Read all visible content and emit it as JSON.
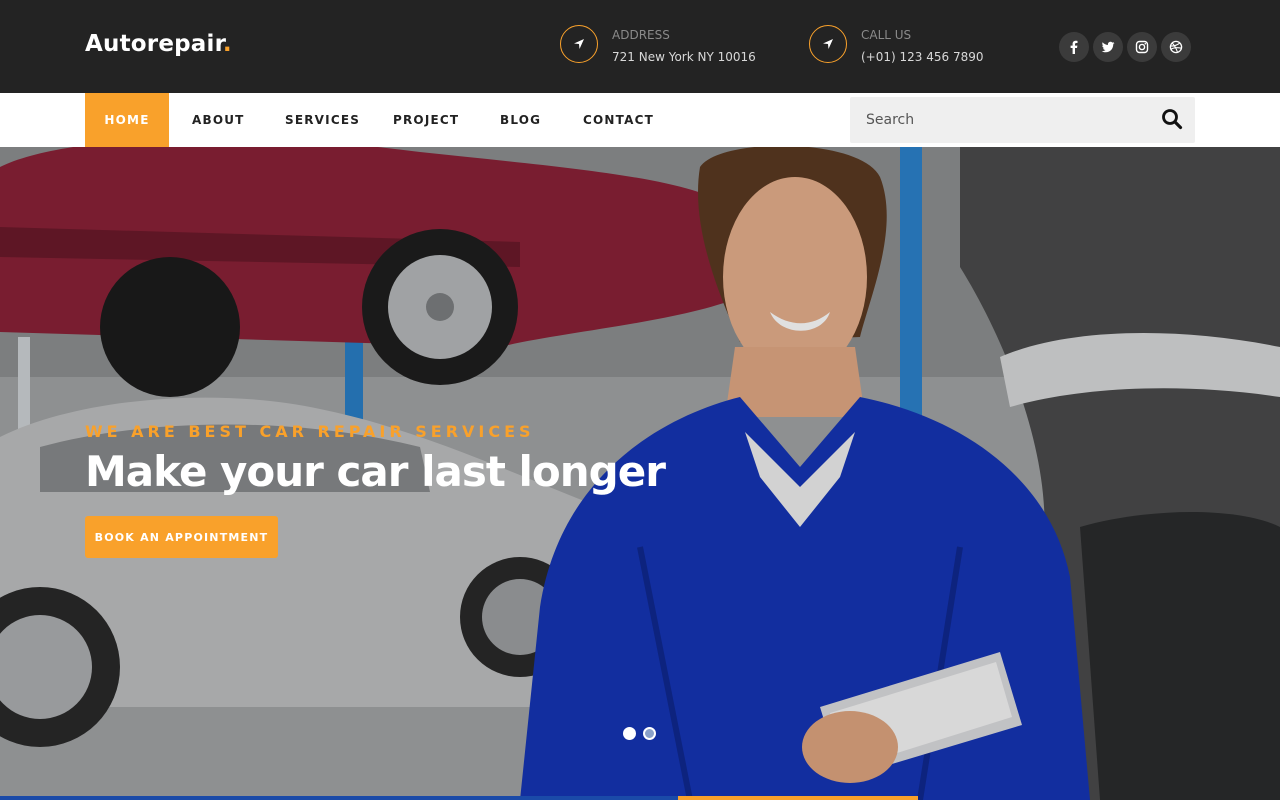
{
  "brand": {
    "name": "Autorepair",
    "dot": "."
  },
  "contact": {
    "address": {
      "label": "ADDRESS",
      "value": "721 New York NY 10016",
      "icon": "location-arrow-icon"
    },
    "phone": {
      "label": "CALL US",
      "value": "(+01) 123 456 7890",
      "icon": "location-arrow-icon"
    }
  },
  "social": [
    {
      "name": "facebook",
      "icon": "facebook-icon"
    },
    {
      "name": "twitter",
      "icon": "twitter-icon"
    },
    {
      "name": "instagram",
      "icon": "instagram-icon"
    },
    {
      "name": "dribbble",
      "icon": "dribbble-icon"
    }
  ],
  "nav": {
    "items": [
      {
        "label": "HOME",
        "active": true
      },
      {
        "label": "ABOUT",
        "active": false
      },
      {
        "label": "SERVICES",
        "active": false
      },
      {
        "label": "PROJECT",
        "active": false
      },
      {
        "label": "BLOG",
        "active": false
      },
      {
        "label": "CONTACT",
        "active": false
      }
    ]
  },
  "search": {
    "placeholder": "Search",
    "icon": "search-icon"
  },
  "hero": {
    "subtitle": "WE ARE BEST CAR REPAIR SERVICES",
    "title": "Make your car last longer",
    "cta": "BOOK AN APPOINTMENT",
    "slides": {
      "count": 2,
      "active": 1
    }
  },
  "colors": {
    "accent": "#f9a12b",
    "topbar": "#232323",
    "nav_bg": "#ffffff",
    "strip_blue": "#1a4aa8"
  }
}
